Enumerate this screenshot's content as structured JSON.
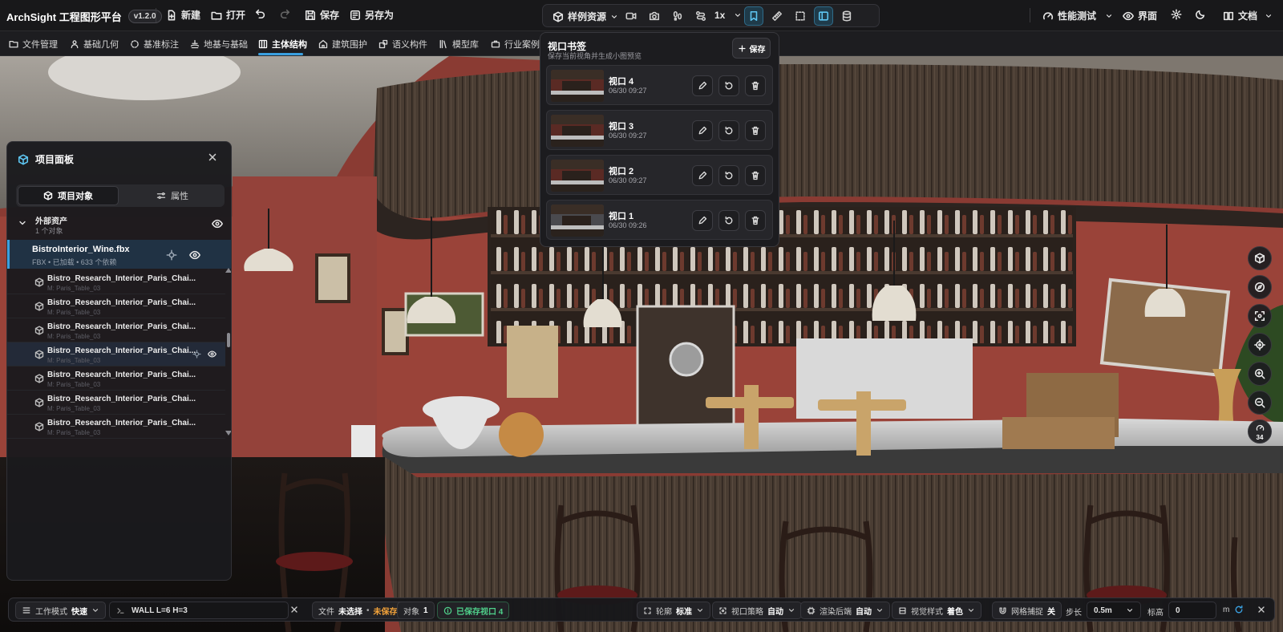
{
  "app": {
    "title": "ArchSight 工程图形平台",
    "version": "v1.2.0"
  },
  "toolbar": {
    "new_label": "新建",
    "open_label": "打开",
    "save_label": "保存",
    "save_as_label": "另存为",
    "samples_label": "样例资源",
    "speed_label": "1x",
    "perf_label": "性能测试",
    "ui_label": "界面",
    "docs_label": "文档"
  },
  "tabs": [
    {
      "label": "文件管理",
      "icon": "folder-icon"
    },
    {
      "label": "基础几何",
      "icon": "person-icon"
    },
    {
      "label": "基准标注",
      "icon": "target-icon"
    },
    {
      "label": "地基与基础",
      "icon": "foundation-icon"
    },
    {
      "label": "主体结构",
      "icon": "grid-icon",
      "active": true
    },
    {
      "label": "建筑围护",
      "icon": "building-icon"
    },
    {
      "label": "语义构件",
      "icon": "component-icon"
    },
    {
      "label": "模型库",
      "icon": "library-icon"
    },
    {
      "label": "行业案例",
      "icon": "briefcase-icon"
    }
  ],
  "panel": {
    "title": "项目面板",
    "tab_objects": "项目对象",
    "tab_props": "属性",
    "group_title": "外部资产",
    "group_sub": "1 个对象",
    "file_name": "BistroInterior_Wine.fbx",
    "file_sub": "FBX • 已加载 • 633 个依赖",
    "objects": [
      {
        "name": "Bistro_Research_Interior_Paris_Chai...",
        "sub": "M: Paris_Table_03"
      },
      {
        "name": "Bistro_Research_Interior_Paris_Chai...",
        "sub": "M: Paris_Table_03"
      },
      {
        "name": "Bistro_Research_Interior_Paris_Chai...",
        "sub": "M: Paris_Table_03"
      },
      {
        "name": "Bistro_Research_Interior_Paris_Chai...",
        "sub": "M: Paris_Table_03",
        "highlight": true
      },
      {
        "name": "Bistro_Research_Interior_Paris_Chai...",
        "sub": "M: Paris_Table_03"
      },
      {
        "name": "Bistro_Research_Interior_Paris_Chai...",
        "sub": "M: Paris_Table_03"
      },
      {
        "name": "Bistro_Research_Interior_Paris_Chai...",
        "sub": "M: Paris_Table_03"
      }
    ]
  },
  "bookmarks": {
    "title": "视口书签",
    "subtitle": "保存当前视角并生成小图预览",
    "save_label": "保存",
    "items": [
      {
        "name": "视口 4",
        "time": "06/30 09:27"
      },
      {
        "name": "视口 3",
        "time": "06/30 09:27"
      },
      {
        "name": "视口 2",
        "time": "06/30 09:27"
      },
      {
        "name": "视口 1",
        "time": "06/30 09:26"
      }
    ]
  },
  "nav": {
    "count": "34"
  },
  "statusbar": {
    "mode_label": "工作模式",
    "mode_value": "快速",
    "command_value": "WALL L=6 H=3",
    "file_label": "文件",
    "file_value": "未选择",
    "file_state": "未保存",
    "objects_label": "对象",
    "objects_value": "1",
    "saved_views": "已保存视口 4",
    "outline_label": "轮廓",
    "outline_value": "标准",
    "viewport_label": "视口策略",
    "viewport_value": "自动",
    "render_label": "渲染后端",
    "render_value": "自动",
    "style_label": "视觉样式",
    "style_value": "着色",
    "snap_label": "网格捕捉",
    "snap_value": "关",
    "step_label": "步长",
    "step_value": "0.5m",
    "elev_label": "标高",
    "elev_value": "0",
    "unit": "m"
  },
  "colors": {
    "accent": "#3aa0e0",
    "warning": "#f2a23a",
    "success": "#4fd08a",
    "wall": "#8a3b33"
  }
}
